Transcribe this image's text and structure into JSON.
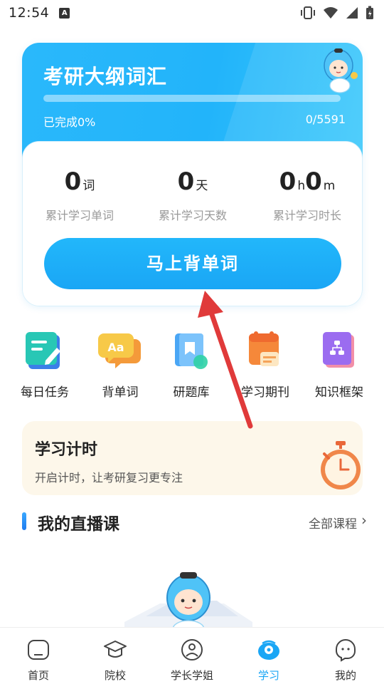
{
  "status_bar": {
    "time": "12:54",
    "notification_glyph": "A"
  },
  "vocab_card": {
    "title": "考研大纲词汇",
    "progress_fraction": 0,
    "progress_label": "已完成0%",
    "progress_count": "0/5591",
    "stats": [
      {
        "value": "0",
        "unit": "词",
        "label": "累计学习单词"
      },
      {
        "value": "0",
        "unit": "天",
        "label": "累计学习天数"
      },
      {
        "value_h": "0",
        "unit_h": "h",
        "value_m": "0",
        "unit_m": "m",
        "label": "累计学习时长"
      }
    ],
    "start_button_label": "马上背单词"
  },
  "quick_actions": [
    {
      "label": "每日任务",
      "icon": "daily-task-icon"
    },
    {
      "label": "背单词",
      "icon": "vocabulary-icon"
    },
    {
      "label": "研题库",
      "icon": "question-bank-icon"
    },
    {
      "label": "学习期刊",
      "icon": "journal-icon"
    },
    {
      "label": "知识框架",
      "icon": "knowledge-framework-icon"
    }
  ],
  "timer_card": {
    "title": "学习计时",
    "subtitle": "开启计时，让考研复习更专注"
  },
  "live_section": {
    "title": "我的直播课",
    "all_link": "全部课程"
  },
  "bottom_nav": [
    {
      "label": "首页",
      "icon": "home-icon",
      "active": false
    },
    {
      "label": "院校",
      "icon": "school-icon",
      "active": false
    },
    {
      "label": "学长学姐",
      "icon": "senior-icon",
      "active": false
    },
    {
      "label": "学习",
      "icon": "study-icon",
      "active": true
    },
    {
      "label": "我的",
      "icon": "profile-icon",
      "active": false
    }
  ],
  "colors": {
    "accent": "#1aa6f5",
    "card_gradient_start": "#2ab8fb",
    "timer_bg": "#fdf7ea",
    "annotation_arrow": "#e03a3a"
  }
}
